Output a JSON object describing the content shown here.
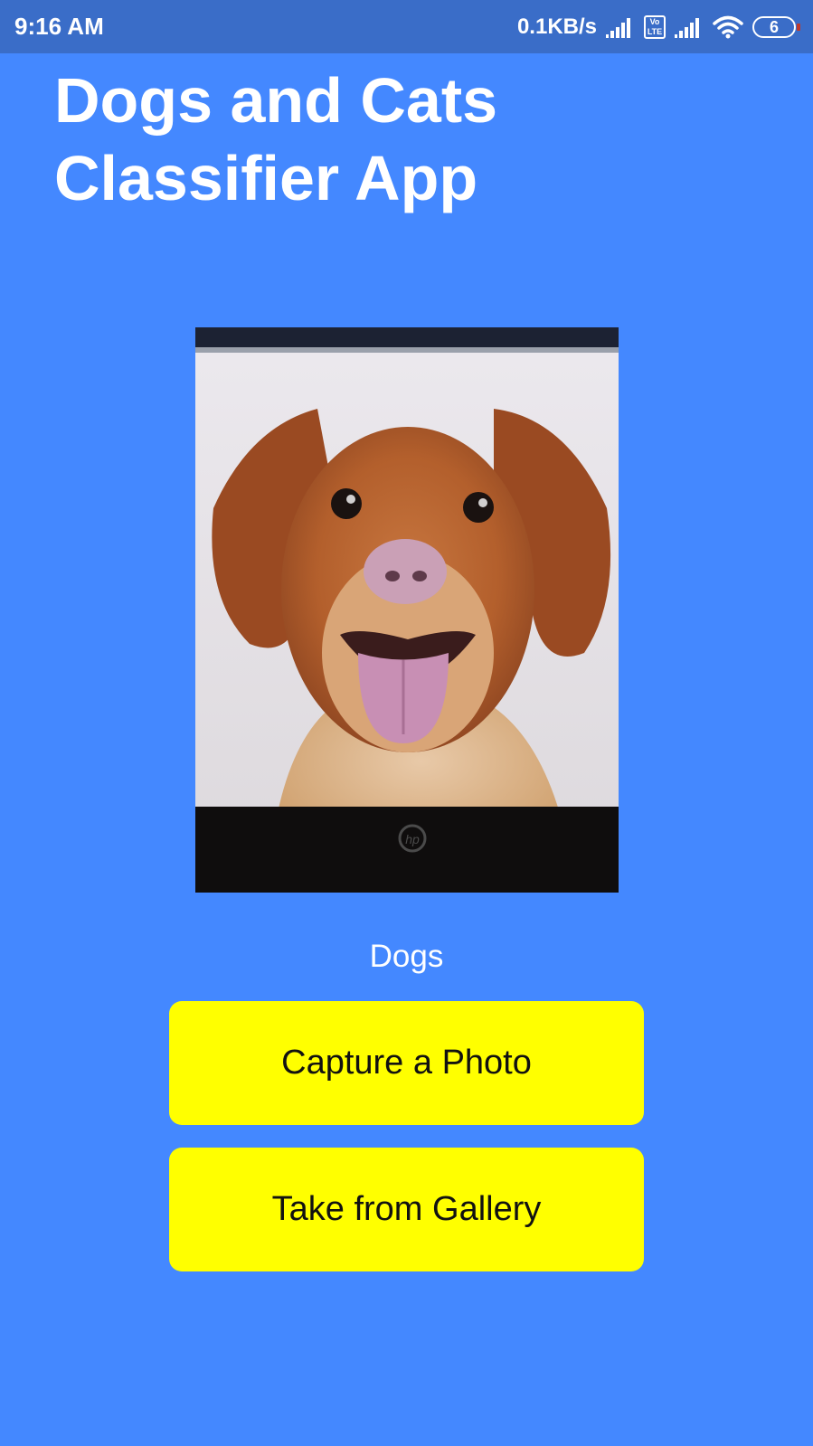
{
  "status_bar": {
    "time": "9:16 AM",
    "network_speed": "0.1KB/s",
    "volte_label_top": "Vo",
    "volte_label_bottom": "LTE",
    "battery_level": "6",
    "icons": [
      "signal-icon",
      "volte-icon",
      "signal-icon",
      "wifi-icon",
      "battery-icon"
    ]
  },
  "app": {
    "title": "Dogs and Cats Classifier App",
    "result": "Dogs",
    "colors": {
      "background": "#4488ff",
      "status_bar": "#3a6dc8",
      "button": "#ffff00",
      "button_text": "#111111"
    }
  },
  "photo": {
    "subject": "dog-photo",
    "laptop_brand_mark": "hp"
  },
  "buttons": {
    "capture": "Capture a Photo",
    "gallery": "Take from Gallery"
  }
}
